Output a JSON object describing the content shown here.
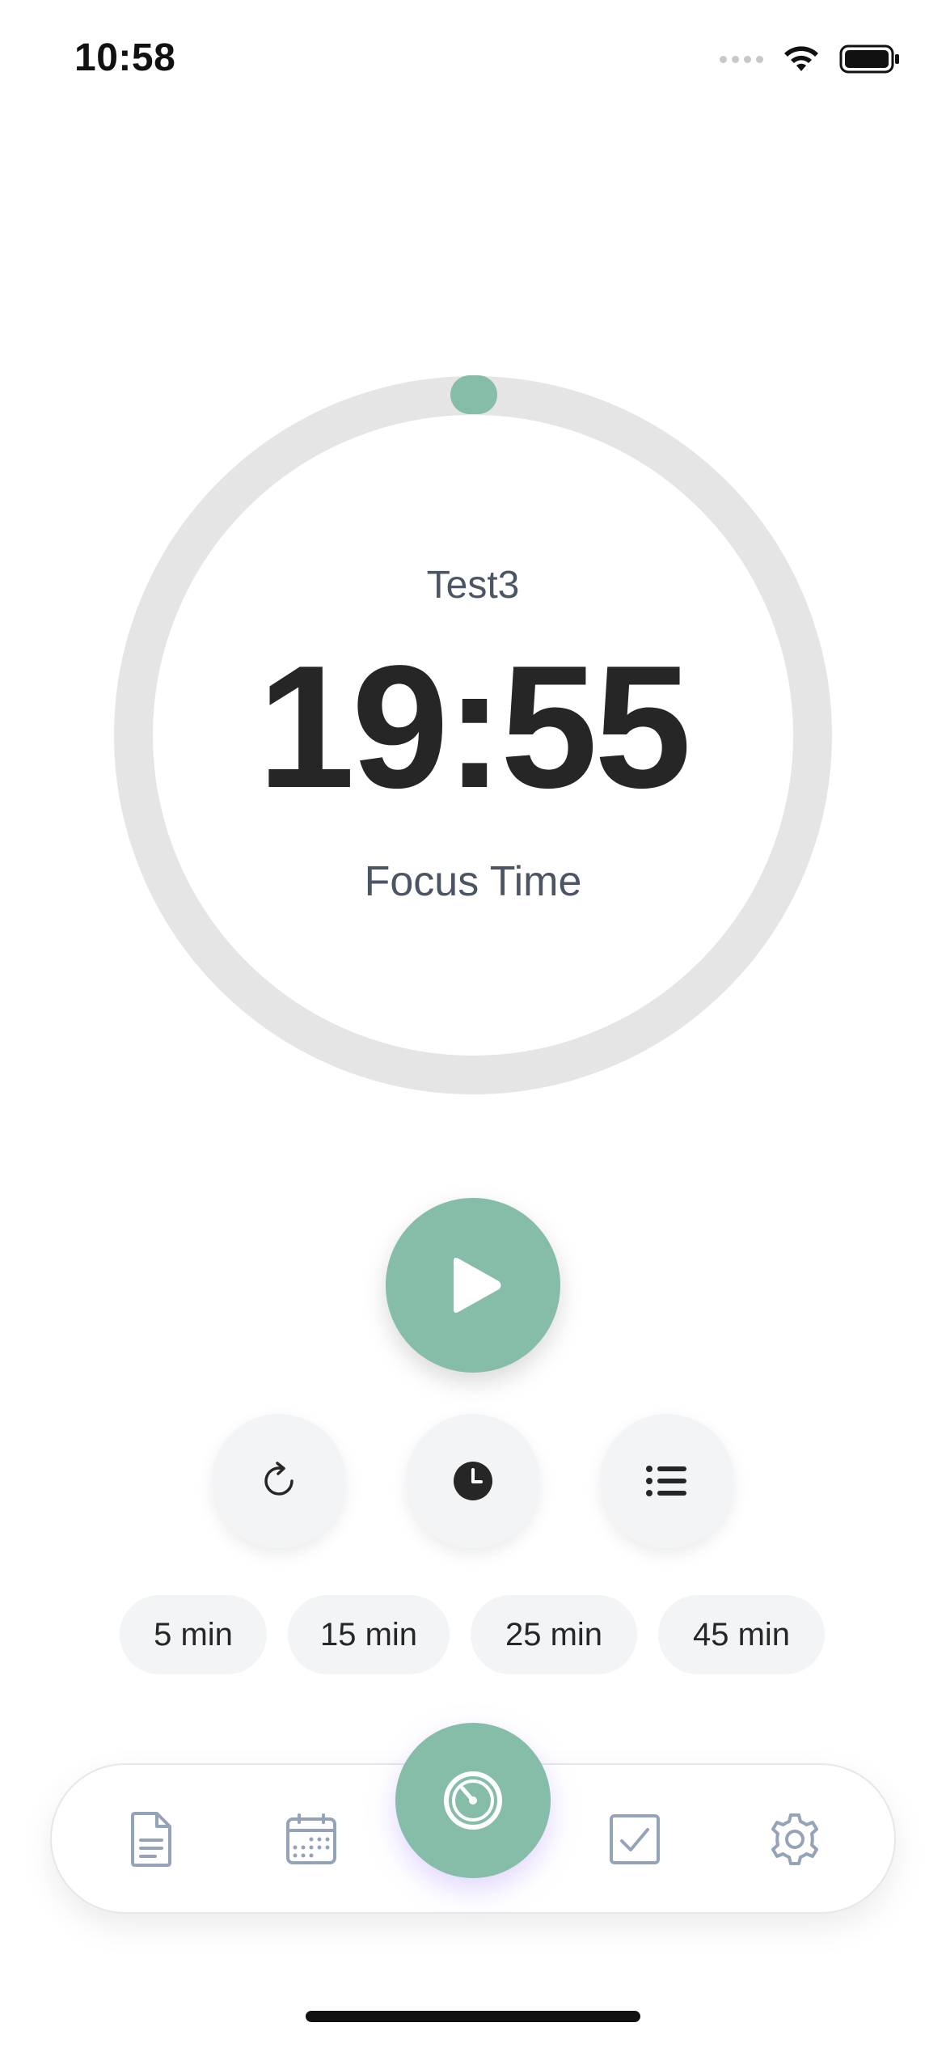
{
  "status_bar": {
    "time": "10:58",
    "icons": [
      "signal-icon",
      "wifi-icon",
      "battery-icon"
    ]
  },
  "timer": {
    "session_name": "Test3",
    "time_remaining": "19:55",
    "mode_label": "Focus Time",
    "progress": 0.0,
    "ring_color": "#e5e5e5",
    "accent_color": "#86bda9"
  },
  "controls": {
    "play_icon": "play-icon",
    "secondary": [
      "reset-icon",
      "clock-icon",
      "list-icon"
    ]
  },
  "presets": [
    "5 min",
    "15 min",
    "25 min",
    "45 min"
  ],
  "bottom_nav": {
    "items": [
      "notes-icon",
      "calendar-icon",
      "timer-icon",
      "tasks-icon",
      "settings-icon"
    ],
    "active": "timer-icon",
    "icon_color": "#94a3b8"
  }
}
